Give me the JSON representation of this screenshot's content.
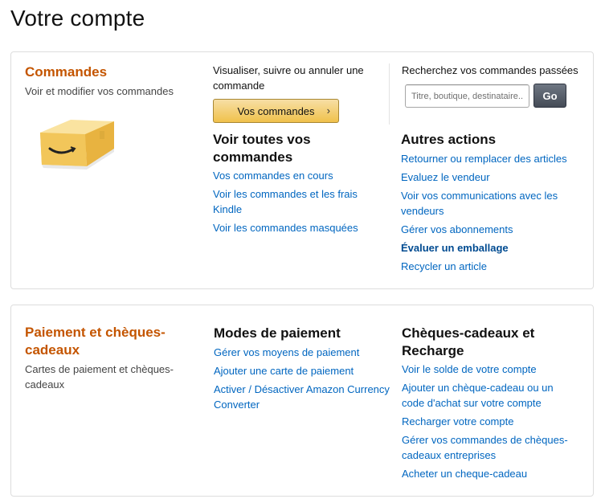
{
  "page": {
    "title": "Votre compte"
  },
  "orders_card": {
    "title": "Commandes",
    "subtitle": "Voir et modifier vos commandes",
    "box_icon": "amazon-box",
    "manage": {
      "text": "Visualiser, suivre ou annuler une commande",
      "button_label": "Vos commandes",
      "button_chevron": "›"
    },
    "search": {
      "label": "Recherchez vos commandes passées",
      "placeholder": "Titre, boutique, destinataire...",
      "go_label": "Go"
    },
    "view_all": {
      "title": "Voir toutes vos commandes",
      "links": [
        "Vos commandes en cours",
        "Voir les commandes et les frais Kindle",
        "Voir les commandes masquées"
      ]
    },
    "other_actions": {
      "title": "Autres actions",
      "links": [
        "Retourner ou remplacer des articles",
        "Evaluez le vendeur",
        "Voir vos communications avec les vendeurs",
        "Gérer vos abonnements",
        "Évaluer un emballage",
        "Recycler un article"
      ]
    }
  },
  "payment_card": {
    "title": "Paiement et chèques-cadeaux",
    "subtitle": "Cartes de paiement et chèques-cadeaux",
    "payment_methods": {
      "title": "Modes de paiement",
      "links": [
        "Gérer vos moyens de paiement",
        "Ajouter une carte de paiement",
        "Activer / Désactiver Amazon Currency Converter"
      ]
    },
    "gift_cards": {
      "title": "Chèques-cadeaux et Recharge",
      "links": [
        "Voir le solde de votre compte",
        "Ajouter un chèque-cadeau ou un code d'achat sur votre compte",
        "Recharger votre compte",
        "Gérer vos commandes de chèques-cadeaux entreprises",
        "Acheter un cheque-cadeau"
      ]
    }
  },
  "colors": {
    "section_title": "#c45500",
    "link": "#0066c0",
    "button_yellow": "#f0c14b",
    "button_dark": "#454c57"
  }
}
